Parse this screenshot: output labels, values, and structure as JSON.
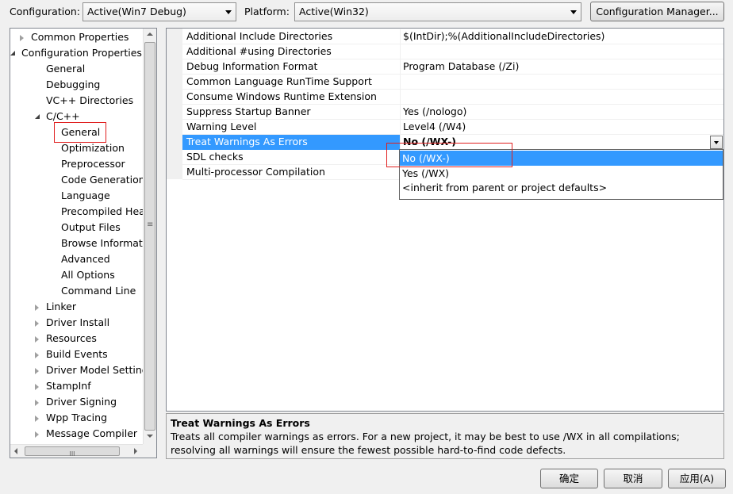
{
  "toolbar": {
    "configuration_label": "Configuration:",
    "configuration_value": "Active(Win7 Debug)",
    "platform_label": "Platform:",
    "platform_value": "Active(Win32)",
    "config_manager_button": "Configuration Manager..."
  },
  "tree": {
    "items": [
      {
        "label": "Common Properties",
        "expander": "collapsed"
      },
      {
        "label": "Configuration Properties",
        "expander": "expanded"
      },
      {
        "label": "General"
      },
      {
        "label": "Debugging"
      },
      {
        "label": "VC++ Directories"
      },
      {
        "label": "C/C++",
        "expander": "expanded"
      },
      {
        "label": "General",
        "selected": true
      },
      {
        "label": "Optimization"
      },
      {
        "label": "Preprocessor"
      },
      {
        "label": "Code Generation"
      },
      {
        "label": "Language"
      },
      {
        "label": "Precompiled Head"
      },
      {
        "label": "Output Files"
      },
      {
        "label": "Browse Informatio"
      },
      {
        "label": "Advanced"
      },
      {
        "label": "All Options"
      },
      {
        "label": "Command Line"
      },
      {
        "label": "Linker",
        "expander": "collapsed"
      },
      {
        "label": "Driver Install",
        "expander": "collapsed"
      },
      {
        "label": "Resources",
        "expander": "collapsed"
      },
      {
        "label": "Build Events",
        "expander": "collapsed"
      },
      {
        "label": "Driver Model Setting",
        "expander": "collapsed"
      },
      {
        "label": "StampInf",
        "expander": "collapsed"
      },
      {
        "label": "Driver Signing",
        "expander": "collapsed"
      },
      {
        "label": "Wpp Tracing",
        "expander": "collapsed"
      },
      {
        "label": "Message Compiler",
        "expander": "collapsed"
      }
    ],
    "hscroll_thumb_glyph": "III",
    "vscroll_thumb_glyph": "≡"
  },
  "properties": [
    {
      "name": "Additional Include Directories",
      "value": "$(IntDir);%(AdditionalIncludeDirectories)"
    },
    {
      "name": "Additional #using Directories",
      "value": ""
    },
    {
      "name": "Debug Information Format",
      "value": "Program Database (/Zi)"
    },
    {
      "name": "Common Language RunTime Support",
      "value": ""
    },
    {
      "name": "Consume Windows Runtime Extension",
      "value": ""
    },
    {
      "name": "Suppress Startup Banner",
      "value": "Yes (/nologo)"
    },
    {
      "name": "Warning Level",
      "value": "Level4 (/W4)"
    },
    {
      "name": "Treat Warnings As Errors",
      "value": "No (/WX-)",
      "selected": true
    },
    {
      "name": "SDL checks",
      "value": ""
    },
    {
      "name": "Multi-processor Compilation",
      "value": ""
    }
  ],
  "dropdown_options": [
    "No (/WX-)",
    "Yes (/WX)",
    "<inherit from parent or project defaults>"
  ],
  "description": {
    "title": "Treat Warnings As Errors",
    "text": "Treats all compiler warnings as errors. For a new project, it may be best to use /WX in all compilations; resolving all warnings will ensure the fewest possible hard-to-find code defects."
  },
  "buttons": {
    "ok": "确定",
    "cancel": "取消",
    "apply": "应用(A)"
  },
  "colors": {
    "selection": "#3399ff",
    "highlight_box": "#e02020"
  }
}
